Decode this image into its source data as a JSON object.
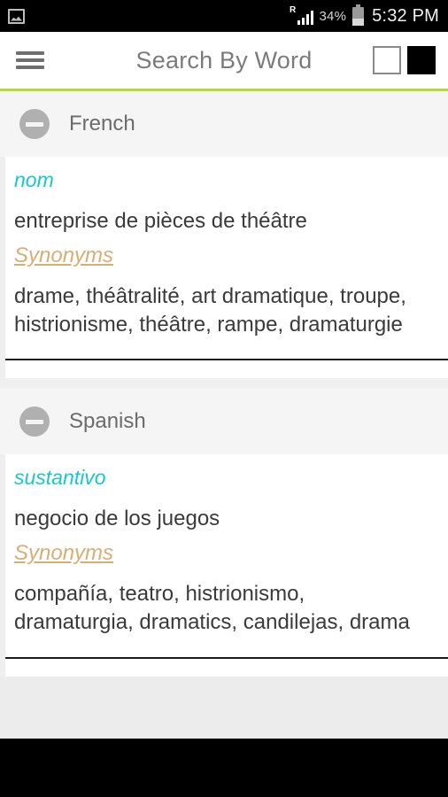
{
  "status_bar": {
    "notification_icon": "screenshot-icon",
    "roaming_indicator": "R",
    "signal_icon": "signal-bars-icon",
    "battery_percent": "34%",
    "battery_icon": "battery-icon",
    "time": "5:32 PM"
  },
  "app_bar": {
    "menu_icon": "hamburger-menu-icon",
    "title": "Search By Word",
    "action_light": "light-theme-swatch",
    "action_dark": "dark-theme-swatch"
  },
  "accent_color": "#b7d836",
  "colors": {
    "part_of_speech": "#18c8cd",
    "synonyms_label": "#d9ae74",
    "definition": "#3a3a3a",
    "group_label": "#6b6b6b"
  },
  "groups": [
    {
      "language": "French",
      "collapse_icon": "minus-circle-icon",
      "entries": [
        {
          "part_of_speech": "nom",
          "definition": "entreprise de pièces de théâtre",
          "synonyms_label": "Synonyms",
          "synonyms": "drame, théâtralité, art dramatique, troupe, histrionisme, théâtre, rampe, dramaturgie"
        }
      ]
    },
    {
      "language": "Spanish",
      "collapse_icon": "minus-circle-icon",
      "entries": [
        {
          "part_of_speech": "sustantivo",
          "definition": "negocio de los juegos",
          "synonyms_label": "Synonyms",
          "synonyms": "compañía, teatro, histrionismo, dramaturgia, dramatics, candilejas, drama"
        }
      ]
    }
  ]
}
